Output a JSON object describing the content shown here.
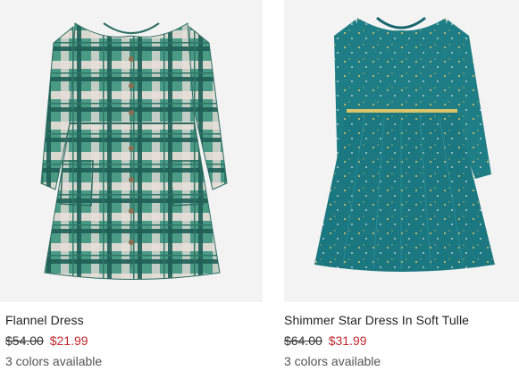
{
  "products": [
    {
      "name": "Flannel Dress",
      "original_price": "$54.00",
      "sale_price": "$21.99",
      "colors_available": "3 colors available",
      "image_icon": "plaid-flannel-dress-image",
      "color_primary": "#3f8f7e"
    },
    {
      "name": "Shimmer Star Dress In Soft Tulle",
      "original_price": "$64.00",
      "sale_price": "$31.99",
      "colors_available": "3 colors available",
      "image_icon": "teal-tulle-star-dress-image",
      "color_primary": "#1f7f86"
    }
  ],
  "colors": {
    "sale": "#c0282d",
    "image_bg": "#f3f3f3"
  }
}
